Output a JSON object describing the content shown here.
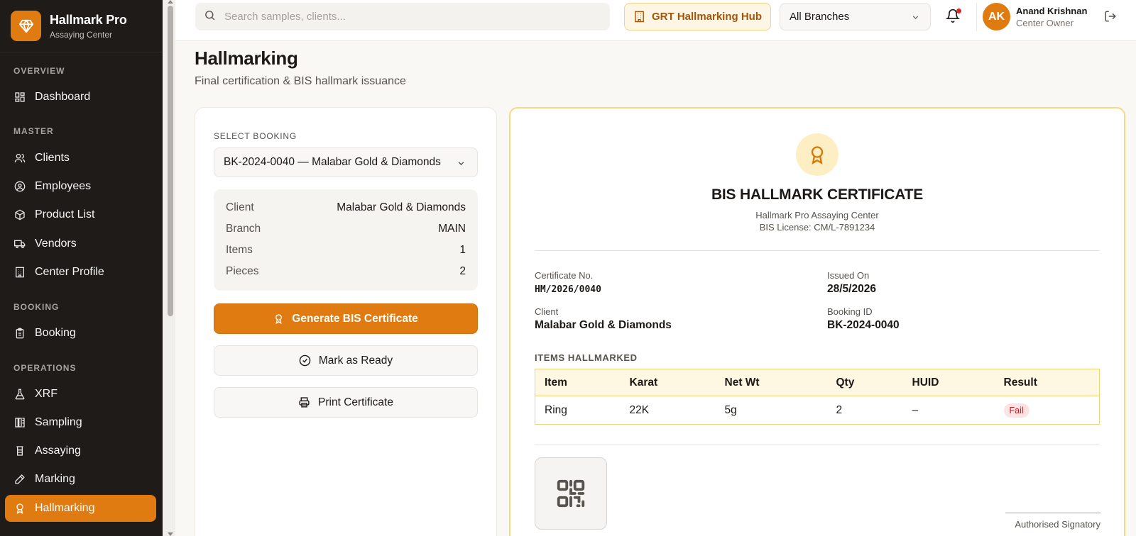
{
  "brand": {
    "name": "Hallmark Pro",
    "subtitle": "Assaying Center",
    "logo_icon": "diamond-icon",
    "color": "#e07b12"
  },
  "sidebar": {
    "sections": [
      {
        "label": "OVERVIEW",
        "items": [
          {
            "label": "Dashboard",
            "icon": "dashboard-icon"
          }
        ]
      },
      {
        "label": "MASTER",
        "items": [
          {
            "label": "Clients",
            "icon": "users-icon"
          },
          {
            "label": "Employees",
            "icon": "user-circle-icon"
          },
          {
            "label": "Product List",
            "icon": "package-icon"
          },
          {
            "label": "Vendors",
            "icon": "truck-icon"
          },
          {
            "label": "Center Profile",
            "icon": "building-icon"
          }
        ]
      },
      {
        "label": "BOOKING",
        "items": [
          {
            "label": "Booking",
            "icon": "clipboard-icon"
          }
        ]
      },
      {
        "label": "OPERATIONS",
        "items": [
          {
            "label": "XRF",
            "icon": "flask-icon"
          },
          {
            "label": "Sampling",
            "icon": "columns-icon"
          },
          {
            "label": "Assaying",
            "icon": "beaker-icon"
          },
          {
            "label": "Marking",
            "icon": "pen-icon"
          },
          {
            "label": "Hallmarking",
            "icon": "award-icon",
            "active": true
          }
        ]
      }
    ]
  },
  "topbar": {
    "search_placeholder": "Search samples, clients...",
    "hub_label": "GRT Hallmarking Hub",
    "branch_selected": "All Branches",
    "user_initials": "AK",
    "user_name": "Anand Krishnan",
    "user_role": "Center Owner"
  },
  "page": {
    "title": "Hallmarking",
    "subtitle": "Final certification & BIS hallmark issuance"
  },
  "booking_panel": {
    "select_label": "SELECT BOOKING",
    "selected_booking": "BK-2024-0040 — Malabar Gold & Diamonds",
    "info": [
      {
        "key": "Client",
        "value": "Malabar Gold & Diamonds"
      },
      {
        "key": "Branch",
        "value": "MAIN"
      },
      {
        "key": "Items",
        "value": "1"
      },
      {
        "key": "Pieces",
        "value": "2"
      }
    ],
    "generate_label": "Generate BIS Certificate",
    "ready_label": "Mark as Ready",
    "print_label": "Print Certificate"
  },
  "certificate": {
    "title": "BIS HALLMARK CERTIFICATE",
    "org": "Hallmark Pro Assaying Center",
    "license": "BIS License: CM/L-7891234",
    "cert_no_label": "Certificate No.",
    "cert_no": "HM/2026/0040",
    "issued_label": "Issued On",
    "issued_on": "28/5/2026",
    "client_label": "Client",
    "client": "Malabar Gold & Diamonds",
    "booking_label": "Booking ID",
    "booking_id": "BK-2024-0040",
    "items_label": "ITEMS HALLMARKED",
    "columns": [
      "Item",
      "Karat",
      "Net Wt",
      "Qty",
      "HUID",
      "Result"
    ],
    "rows": [
      {
        "item": "Ring",
        "karat": "22K",
        "net_wt": "5g",
        "qty": "2",
        "huid": "–",
        "result": "Fail"
      }
    ],
    "signatory": "Authorised Signatory",
    "accent": "#f7d883",
    "fail_color": "#c81e1e"
  }
}
